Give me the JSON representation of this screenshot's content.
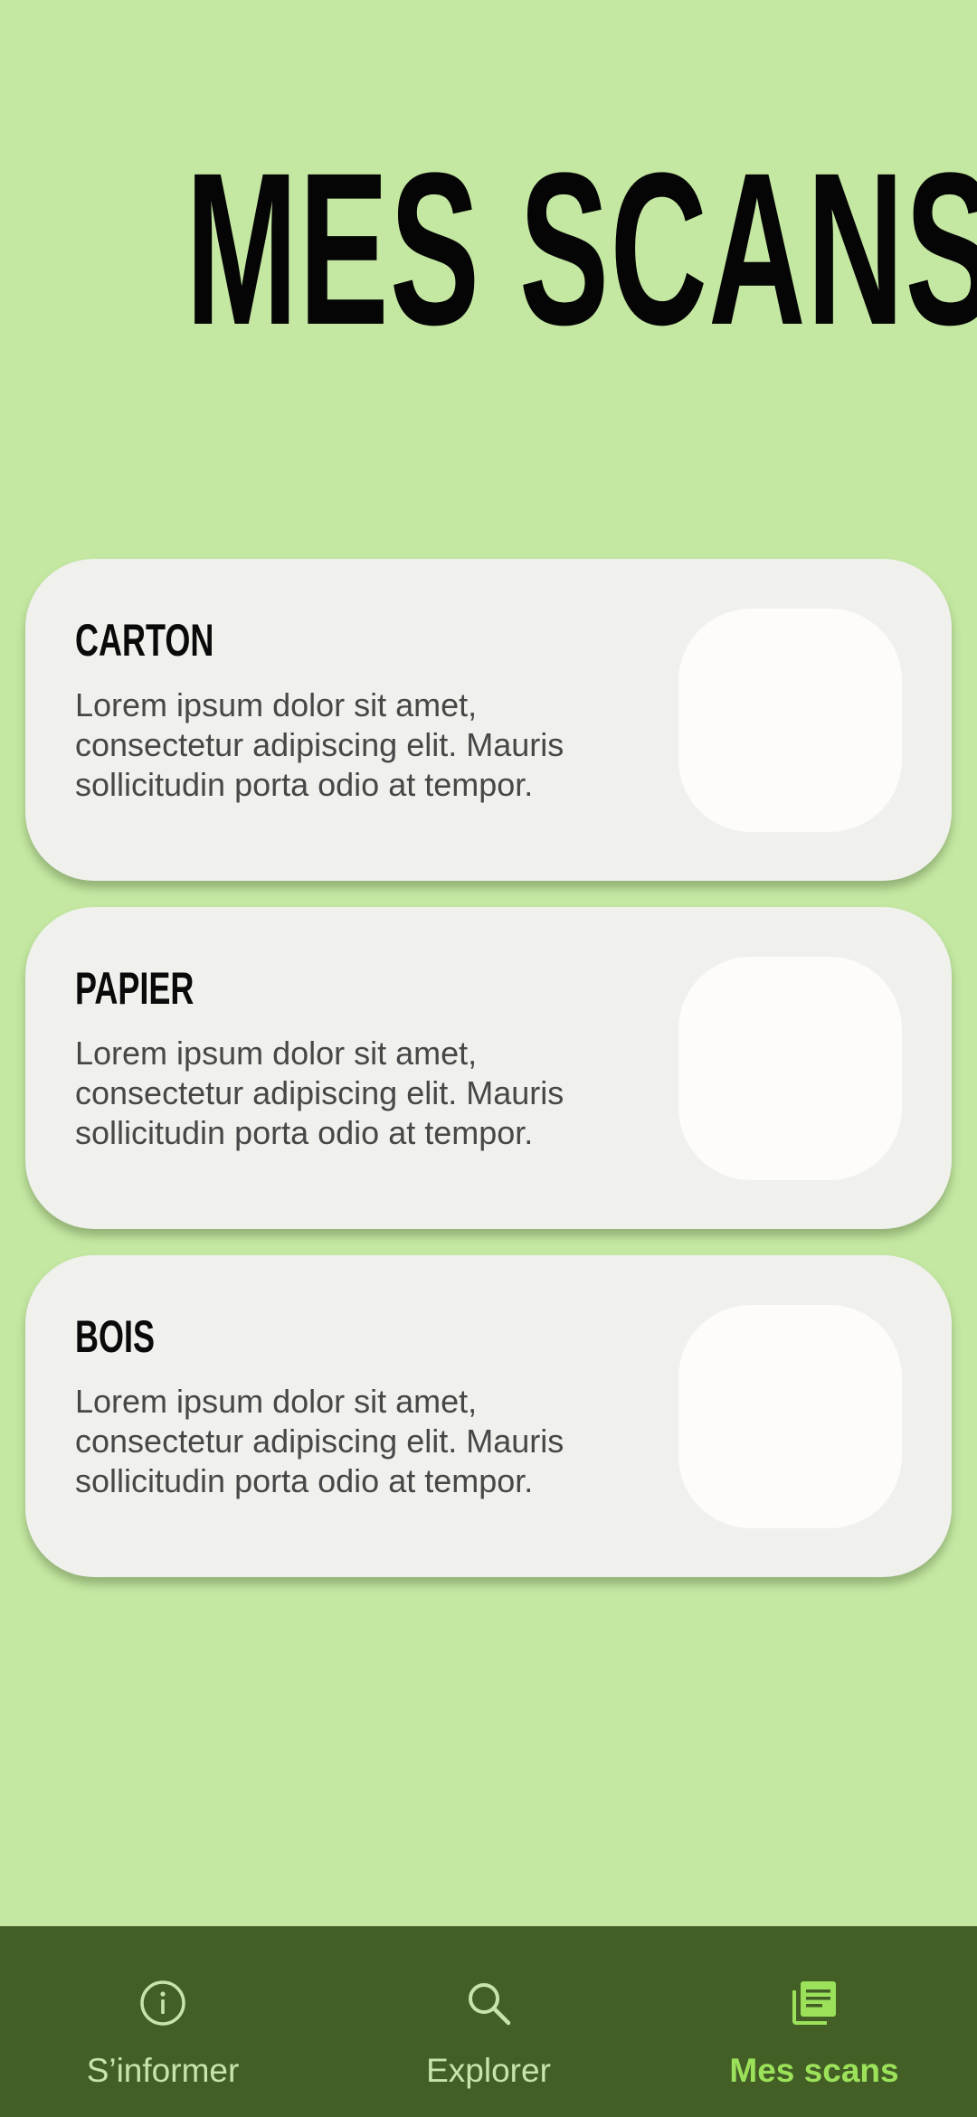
{
  "header": {
    "title": "MES SCANS"
  },
  "cards": [
    {
      "title": "CARTON",
      "text": "Lorem ipsum dolor sit amet, consectetur adipiscing elit. Mauris sollicitudin porta odio at tempor."
    },
    {
      "title": "PAPIER",
      "text": "Lorem ipsum dolor sit amet, consectetur adipiscing elit. Mauris sollicitudin porta odio at tempor."
    },
    {
      "title": "BOIS",
      "text": "Lorem ipsum dolor sit amet, consectetur adipiscing elit. Mauris sollicitudin porta odio at tempor."
    }
  ],
  "bottom_nav": {
    "items": [
      {
        "label": "S’informer",
        "icon": "info-icon",
        "active": false
      },
      {
        "label": "Explorer",
        "icon": "search-icon",
        "active": false
      },
      {
        "label": "Mes scans",
        "icon": "scans-stack-icon",
        "active": true
      }
    ]
  },
  "colors": {
    "background": "#c4e8a2",
    "card": "#f0f0ed",
    "thumbnail": "#fdfcf8",
    "nav_background": "#445f26",
    "nav_inactive": "#c8e4ad",
    "nav_active": "#9be25a"
  }
}
